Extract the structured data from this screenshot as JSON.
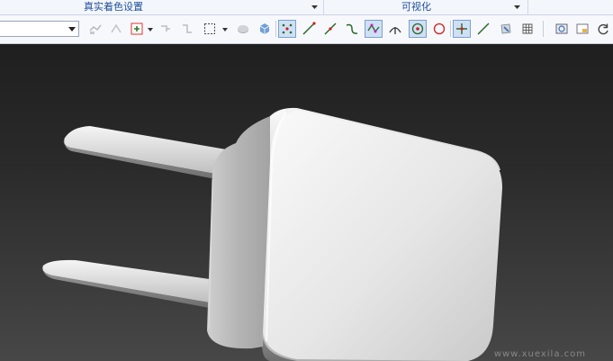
{
  "ribbon_groups": {
    "shading_settings": "真实着色设置",
    "visualization": "可视化"
  },
  "toolbar": {
    "view_dropdown_value": "",
    "buttons": [
      "show-hide-icon",
      "mirror-icon",
      "snap-filter-icon",
      "clip-icon",
      "select-box-icon",
      "view-part-icon",
      "view-solid-icon",
      "snap-grid-icon",
      "snap-line-icon",
      "snap-edge-icon",
      "snap-curve-icon",
      "snap-vertex-icon",
      "snap-midpoint-icon",
      "snap-center-icon",
      "snap-circle-icon",
      "snap-intersection-icon",
      "snap-tangent-icon",
      "edit-appearance-icon",
      "mesh-icon",
      "fit-view-icon",
      "window-icon",
      "refresh-icon"
    ]
  },
  "colors": {
    "group_label": "#1e4f9a",
    "active_button": "#cfe0f5",
    "viewport_top": "#1f1f1f",
    "viewport_bottom": "#474747"
  },
  "viewport": {
    "model": "usb-charger-plug",
    "watermark": "www.xuexila.com"
  }
}
